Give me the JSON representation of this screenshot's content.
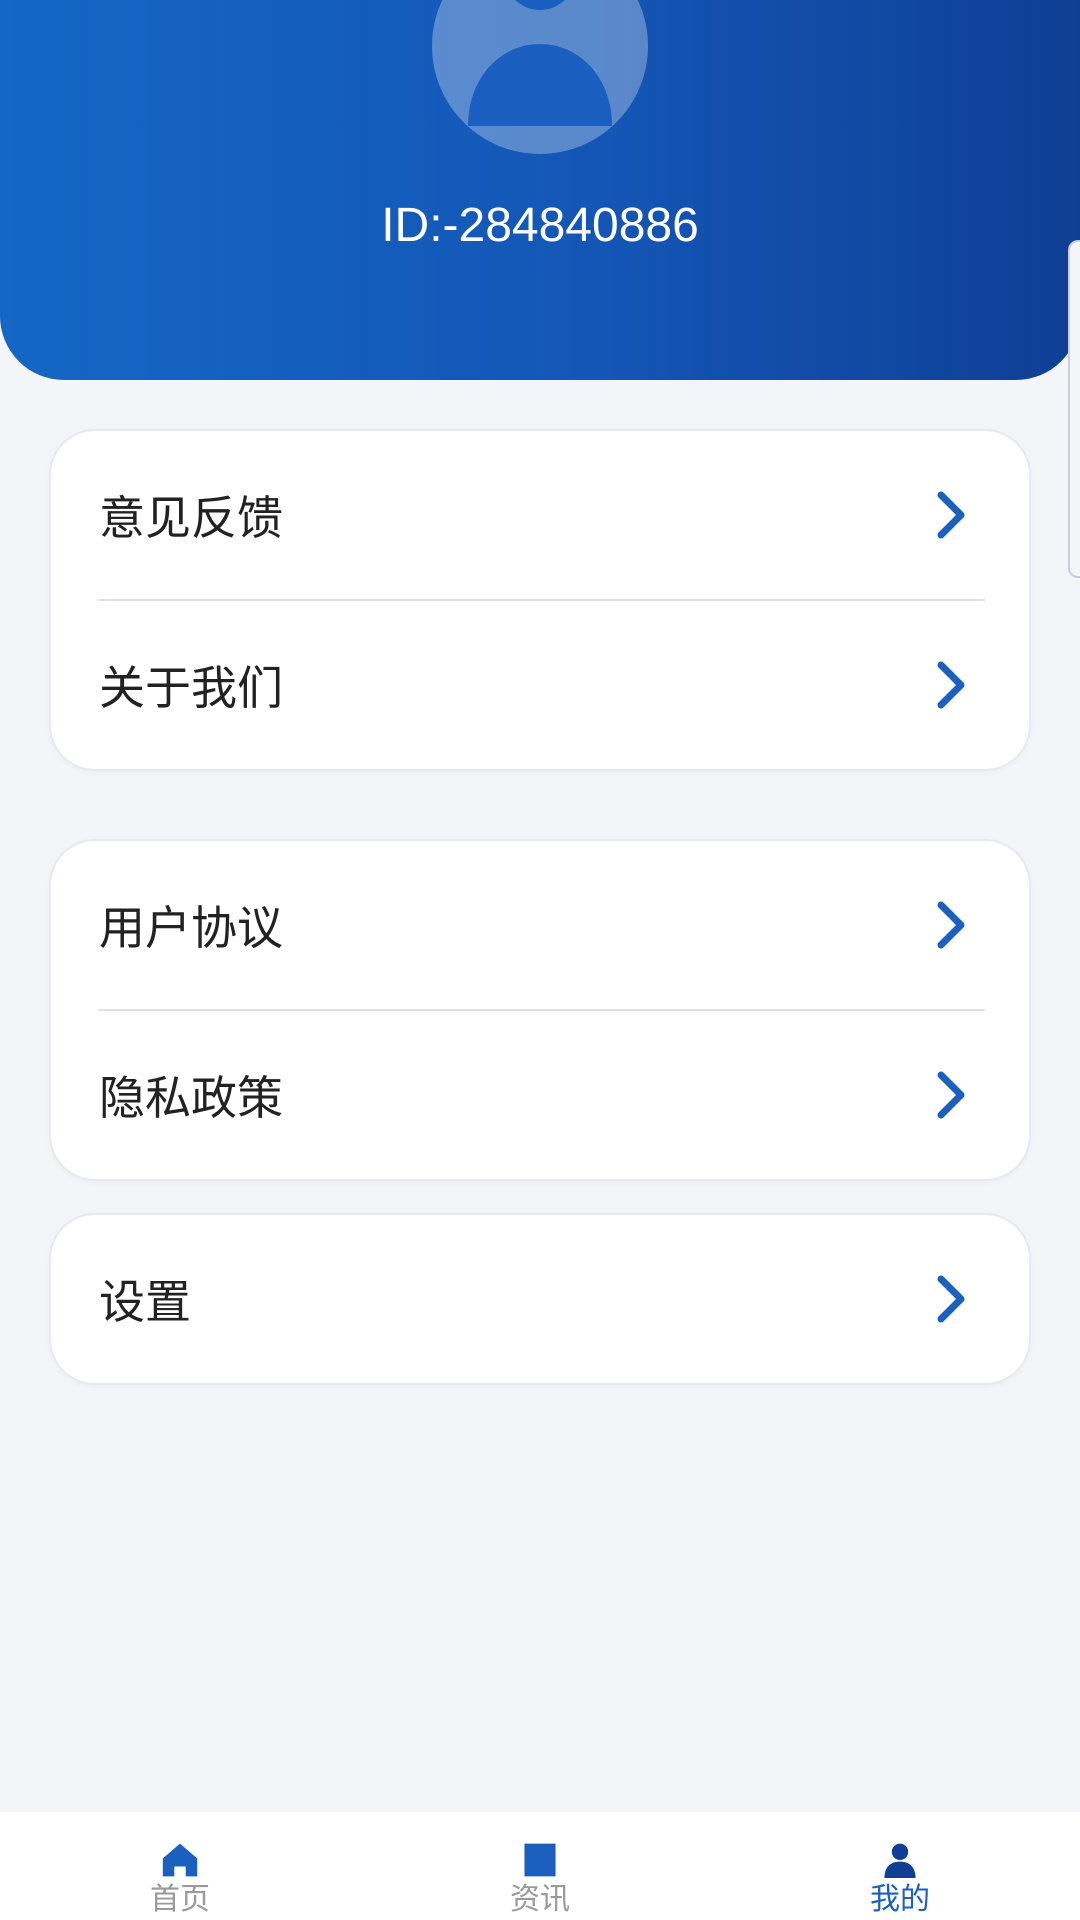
{
  "profile": {
    "user_id": "ID:-284840886",
    "avatar_icon": "user-avatar-icon"
  },
  "menu_groups": [
    {
      "items": [
        {
          "label": "意见反馈",
          "icon": "chevron-right-icon"
        },
        {
          "label": "关于我们",
          "icon": "chevron-right-icon"
        }
      ]
    },
    {
      "items": [
        {
          "label": "用户协议",
          "icon": "chevron-right-icon"
        },
        {
          "label": "隐私政策",
          "icon": "chevron-right-icon"
        }
      ]
    },
    {
      "items": [
        {
          "label": "设置",
          "icon": "chevron-right-icon"
        }
      ]
    }
  ],
  "tabbar": {
    "tabs": [
      {
        "label": "首页",
        "icon": "home-icon",
        "active": false
      },
      {
        "label": "资讯",
        "icon": "news-icon",
        "active": false
      },
      {
        "label": "我的",
        "icon": "profile-icon",
        "active": true
      }
    ]
  },
  "colors": {
    "header_gradient_start": "#1567c5",
    "header_gradient_end": "#0f3f95",
    "accent": "#1b5fbf",
    "inactive_tab": "#9a9a9a",
    "background": "#f4f5f9"
  }
}
